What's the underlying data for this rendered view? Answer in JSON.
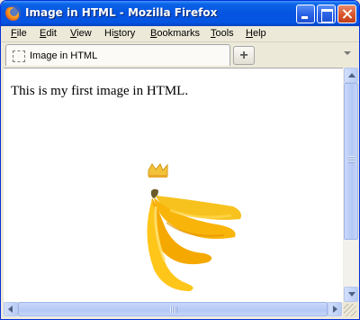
{
  "window": {
    "title": "Image in HTML - Mozilla Firefox"
  },
  "menu": [
    {
      "accel": "F",
      "rest": "ile"
    },
    {
      "accel": "E",
      "rest": "dit"
    },
    {
      "accel": "V",
      "rest": "iew"
    },
    {
      "accel": "",
      "pre": "Hi",
      "mid": "s",
      "rest": "tory"
    },
    {
      "accel": "B",
      "rest": "ookmarks"
    },
    {
      "accel": "T",
      "rest": "ools"
    },
    {
      "accel": "H",
      "rest": "elp"
    }
  ],
  "tab": {
    "label": "Image in HTML",
    "new_tab_symbol": "+"
  },
  "page": {
    "text": "This is my first image in HTML."
  },
  "icons": {
    "app": "firefox-icon",
    "tab": "blank-page-icon",
    "image": "banana-bunch-with-crown"
  },
  "colors": {
    "titlebar": "#0553E0",
    "chrome": "#ECE9D8",
    "banana": "#F5B700"
  }
}
